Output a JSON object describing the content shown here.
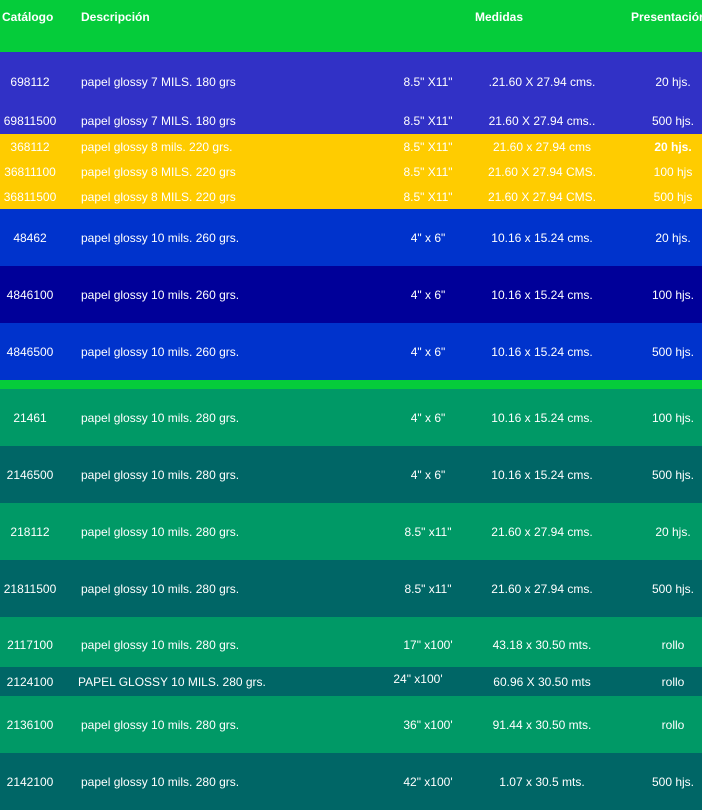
{
  "header": {
    "catalog": "Catálogo",
    "description": "Descripción",
    "measures": "Medidas",
    "presentation": "Presentación"
  },
  "colors": {
    "green": "#05cc3a",
    "purple_blue": "#3131c6",
    "yellow": "#ffcc00",
    "royal_blue": "#0033cc",
    "navy": "#000099",
    "sea_green": "#009966",
    "teal": "#006666"
  },
  "rows": [
    {
      "catalog": "698112",
      "description": "papel glossy 7 MILS. 180 grs",
      "size": "8.5\" X11\"",
      "measures": ".21.60 X 27.94 cms.",
      "presentation": "20 hjs."
    },
    {
      "catalog": "69811500",
      "description": "papel glossy 7 MILS. 180 grs",
      "size": "8.5\" X11\"",
      "measures": "21.60 X 27.94 cms..",
      "presentation": "500 hjs."
    },
    {
      "catalog": "368112",
      "description": "papel glossy  8 mils. 220 grs.",
      "size": "8.5\" X11\"",
      "measures": "21.60 x 27.94 cms",
      "presentation": "20 hjs."
    },
    {
      "catalog": "36811100",
      "description": "papel glossy  8 MILS. 220 grs",
      "size": "8.5\" X11\"",
      "measures": "21.60 X 27.94 CMS.",
      "presentation": "100 hjs"
    },
    {
      "catalog": "36811500",
      "description": "papel glossy 8 MILS. 220 grs",
      "size": "8.5\" X11\"",
      "measures": "21.60 X 27.94 CMS.",
      "presentation": "500 hjs"
    },
    {
      "catalog": "48462",
      "description": "papel glossy  10 mils. 260 grs.",
      "size": "4\" x 6\"",
      "measures": "10.16 x 15.24 cms.",
      "presentation": "20 hjs."
    },
    {
      "catalog": "4846100",
      "description": "papel glossy  10 mils. 260 grs.",
      "size": "4\" x 6\"",
      "measures": "10.16 x 15.24 cms.",
      "presentation": "100 hjs."
    },
    {
      "catalog": "4846500",
      "description": "papel glossy  10 mils. 260 grs.",
      "size": "4\" x 6\"",
      "measures": "10.16 x 15.24 cms.",
      "presentation": "500 hjs."
    },
    {
      "catalog": "21461",
      "description": "papel glossy  10 mils. 280 grs.",
      "size": "4\" x 6\"",
      "measures": "10.16 x 15.24 cms.",
      "presentation": "100 hjs."
    },
    {
      "catalog": "2146500",
      "description": "papel glossy  10 mils. 280 grs.",
      "size": "4\" x 6\"",
      "measures": "10.16 x 15.24 cms.",
      "presentation": "500 hjs."
    },
    {
      "catalog": "218112",
      "description": "papel glossy  10 mils. 280 grs.",
      "size": "8.5\" x11\"",
      "measures": "21.60 x 27.94 cms.",
      "presentation": "20 hjs."
    },
    {
      "catalog": "21811500",
      "description": "papel glossy  10 mils. 280 grs.",
      "size": "8.5\" x11\"",
      "measures": "21.60 x 27.94 cms.",
      "presentation": "500 hjs."
    },
    {
      "catalog": "2117100",
      "description": "papel glossy  10 mils. 280 grs.",
      "size": "17\" x100'",
      "measures": "43.18 x 30.50 mts.",
      "presentation": "rollo"
    },
    {
      "catalog": "2124100",
      "description": "PAPEL GLOSSY 10 MILS. 280 grs.",
      "size": "24\" x100'",
      "measures": "60.96 X 30.50 mts",
      "presentation": "rollo"
    },
    {
      "catalog": "2136100",
      "description": "papel glossy  10 mils. 280 grs.",
      "size": "36\" x100'",
      "measures": "91.44 x 30.50 mts.",
      "presentation": "rollo"
    },
    {
      "catalog": "2142100",
      "description": "papel glossy  10 mils. 280 grs.",
      "size": "42\" x100'",
      "measures": "1.07 x 30.5 mts.",
      "presentation": "500 hjs."
    }
  ]
}
